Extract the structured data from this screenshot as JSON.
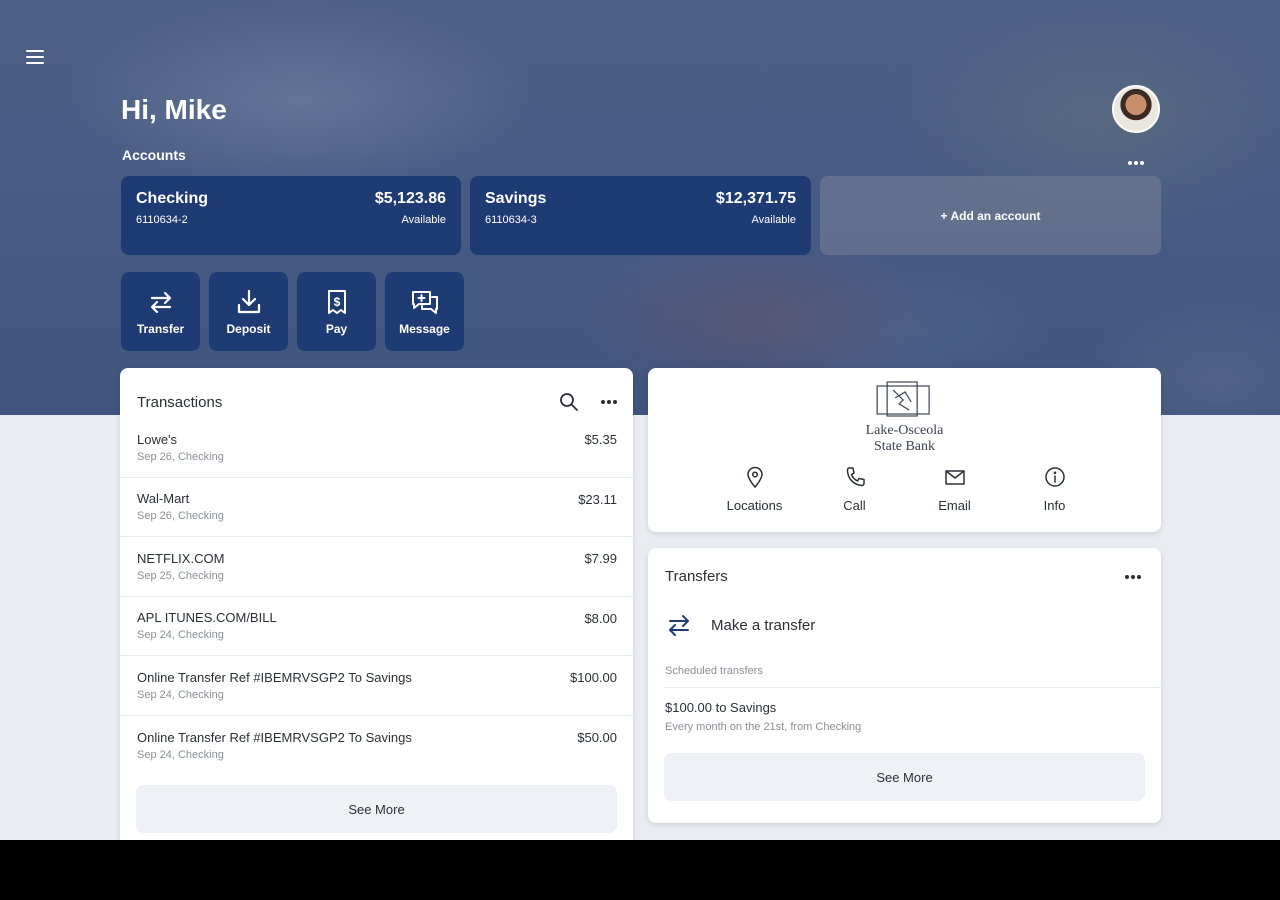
{
  "header": {
    "greeting": "Hi, Mike",
    "accounts_label": "Accounts"
  },
  "accounts": [
    {
      "name": "Checking",
      "number": "6110634-2",
      "balance": "$5,123.86",
      "balance_label": "Available"
    },
    {
      "name": "Savings",
      "number": "6110634-3",
      "balance": "$12,371.75",
      "balance_label": "Available"
    }
  ],
  "add_account_label": "+ Add an account",
  "quick_actions": [
    {
      "label": "Transfer",
      "icon": "transfer-icon"
    },
    {
      "label": "Deposit",
      "icon": "deposit-icon"
    },
    {
      "label": "Pay",
      "icon": "pay-icon"
    },
    {
      "label": "Message",
      "icon": "message-icon"
    }
  ],
  "transactions": {
    "title": "Transactions",
    "items": [
      {
        "name": "Lowe's",
        "detail": "Sep 26, Checking",
        "amount": "$5.35"
      },
      {
        "name": "Wal-Mart",
        "detail": "Sep 26, Checking",
        "amount": "$23.11"
      },
      {
        "name": "NETFLIX.COM",
        "detail": "Sep 25, Checking",
        "amount": "$7.99"
      },
      {
        "name": "APL ITUNES.COM/BILL",
        "detail": "Sep 24, Checking",
        "amount": "$8.00"
      },
      {
        "name": "Online Transfer Ref #IBEMRVSGP2 To Savings",
        "detail": "Sep 24, Checking",
        "amount": "$100.00"
      },
      {
        "name": "Online Transfer Ref #IBEMRVSGP2 To Savings",
        "detail": "Sep 24, Checking",
        "amount": "$50.00"
      }
    ],
    "see_more": "See More"
  },
  "bank": {
    "name_line1": "Lake-Osceola",
    "name_line2": "State Bank",
    "contacts": [
      {
        "label": "Locations",
        "icon": "location-pin-icon"
      },
      {
        "label": "Call",
        "icon": "phone-icon"
      },
      {
        "label": "Email",
        "icon": "email-icon"
      },
      {
        "label": "Info",
        "icon": "info-icon"
      }
    ]
  },
  "transfers": {
    "title": "Transfers",
    "make_transfer": "Make a transfer",
    "scheduled_label": "Scheduled transfers",
    "scheduled": [
      {
        "title": "$100.00 to Savings",
        "detail": "Every month on the 21st, from Checking"
      }
    ],
    "see_more": "See More"
  },
  "colors": {
    "accent": "#1f3b73",
    "background": "#e9edf2",
    "card": "#ffffff"
  }
}
